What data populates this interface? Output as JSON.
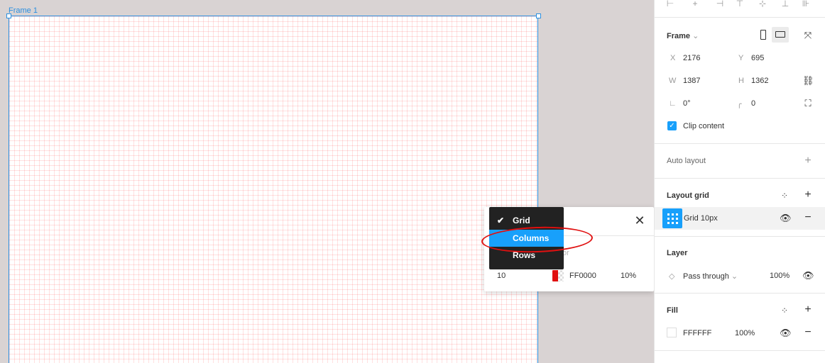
{
  "canvas": {
    "frame_label": "Frame 1"
  },
  "grid_popup": {
    "color_label": "or",
    "size_value": "10",
    "color_hex": "FF0000",
    "opacity": "10%",
    "close_icon": "close-icon"
  },
  "type_menu": {
    "items": [
      {
        "label": "Grid",
        "checked": true
      },
      {
        "label": "Columns",
        "highlighted": true
      },
      {
        "label": "Rows"
      }
    ]
  },
  "panel": {
    "frame": {
      "title": "Frame",
      "x_label": "X",
      "x_value": "2176",
      "y_label": "Y",
      "y_value": "695",
      "w_label": "W",
      "w_value": "1387",
      "h_label": "H",
      "h_value": "1362",
      "rotation": "0°",
      "radius": "0",
      "clip_content": "Clip content"
    },
    "auto_layout": {
      "title": "Auto layout"
    },
    "layout_grid": {
      "title": "Layout grid",
      "item_label": "Grid 10px"
    },
    "layer": {
      "title": "Layer",
      "blend_mode": "Pass through",
      "opacity": "100%"
    },
    "fill": {
      "title": "Fill",
      "hex": "FFFFFF",
      "opacity": "100%"
    }
  },
  "colors": {
    "accent": "#18a0fb",
    "selection": "#2a8fe0",
    "grid_color": "#FF0000",
    "annotation": "#e01010",
    "menu_bg": "#222222"
  }
}
